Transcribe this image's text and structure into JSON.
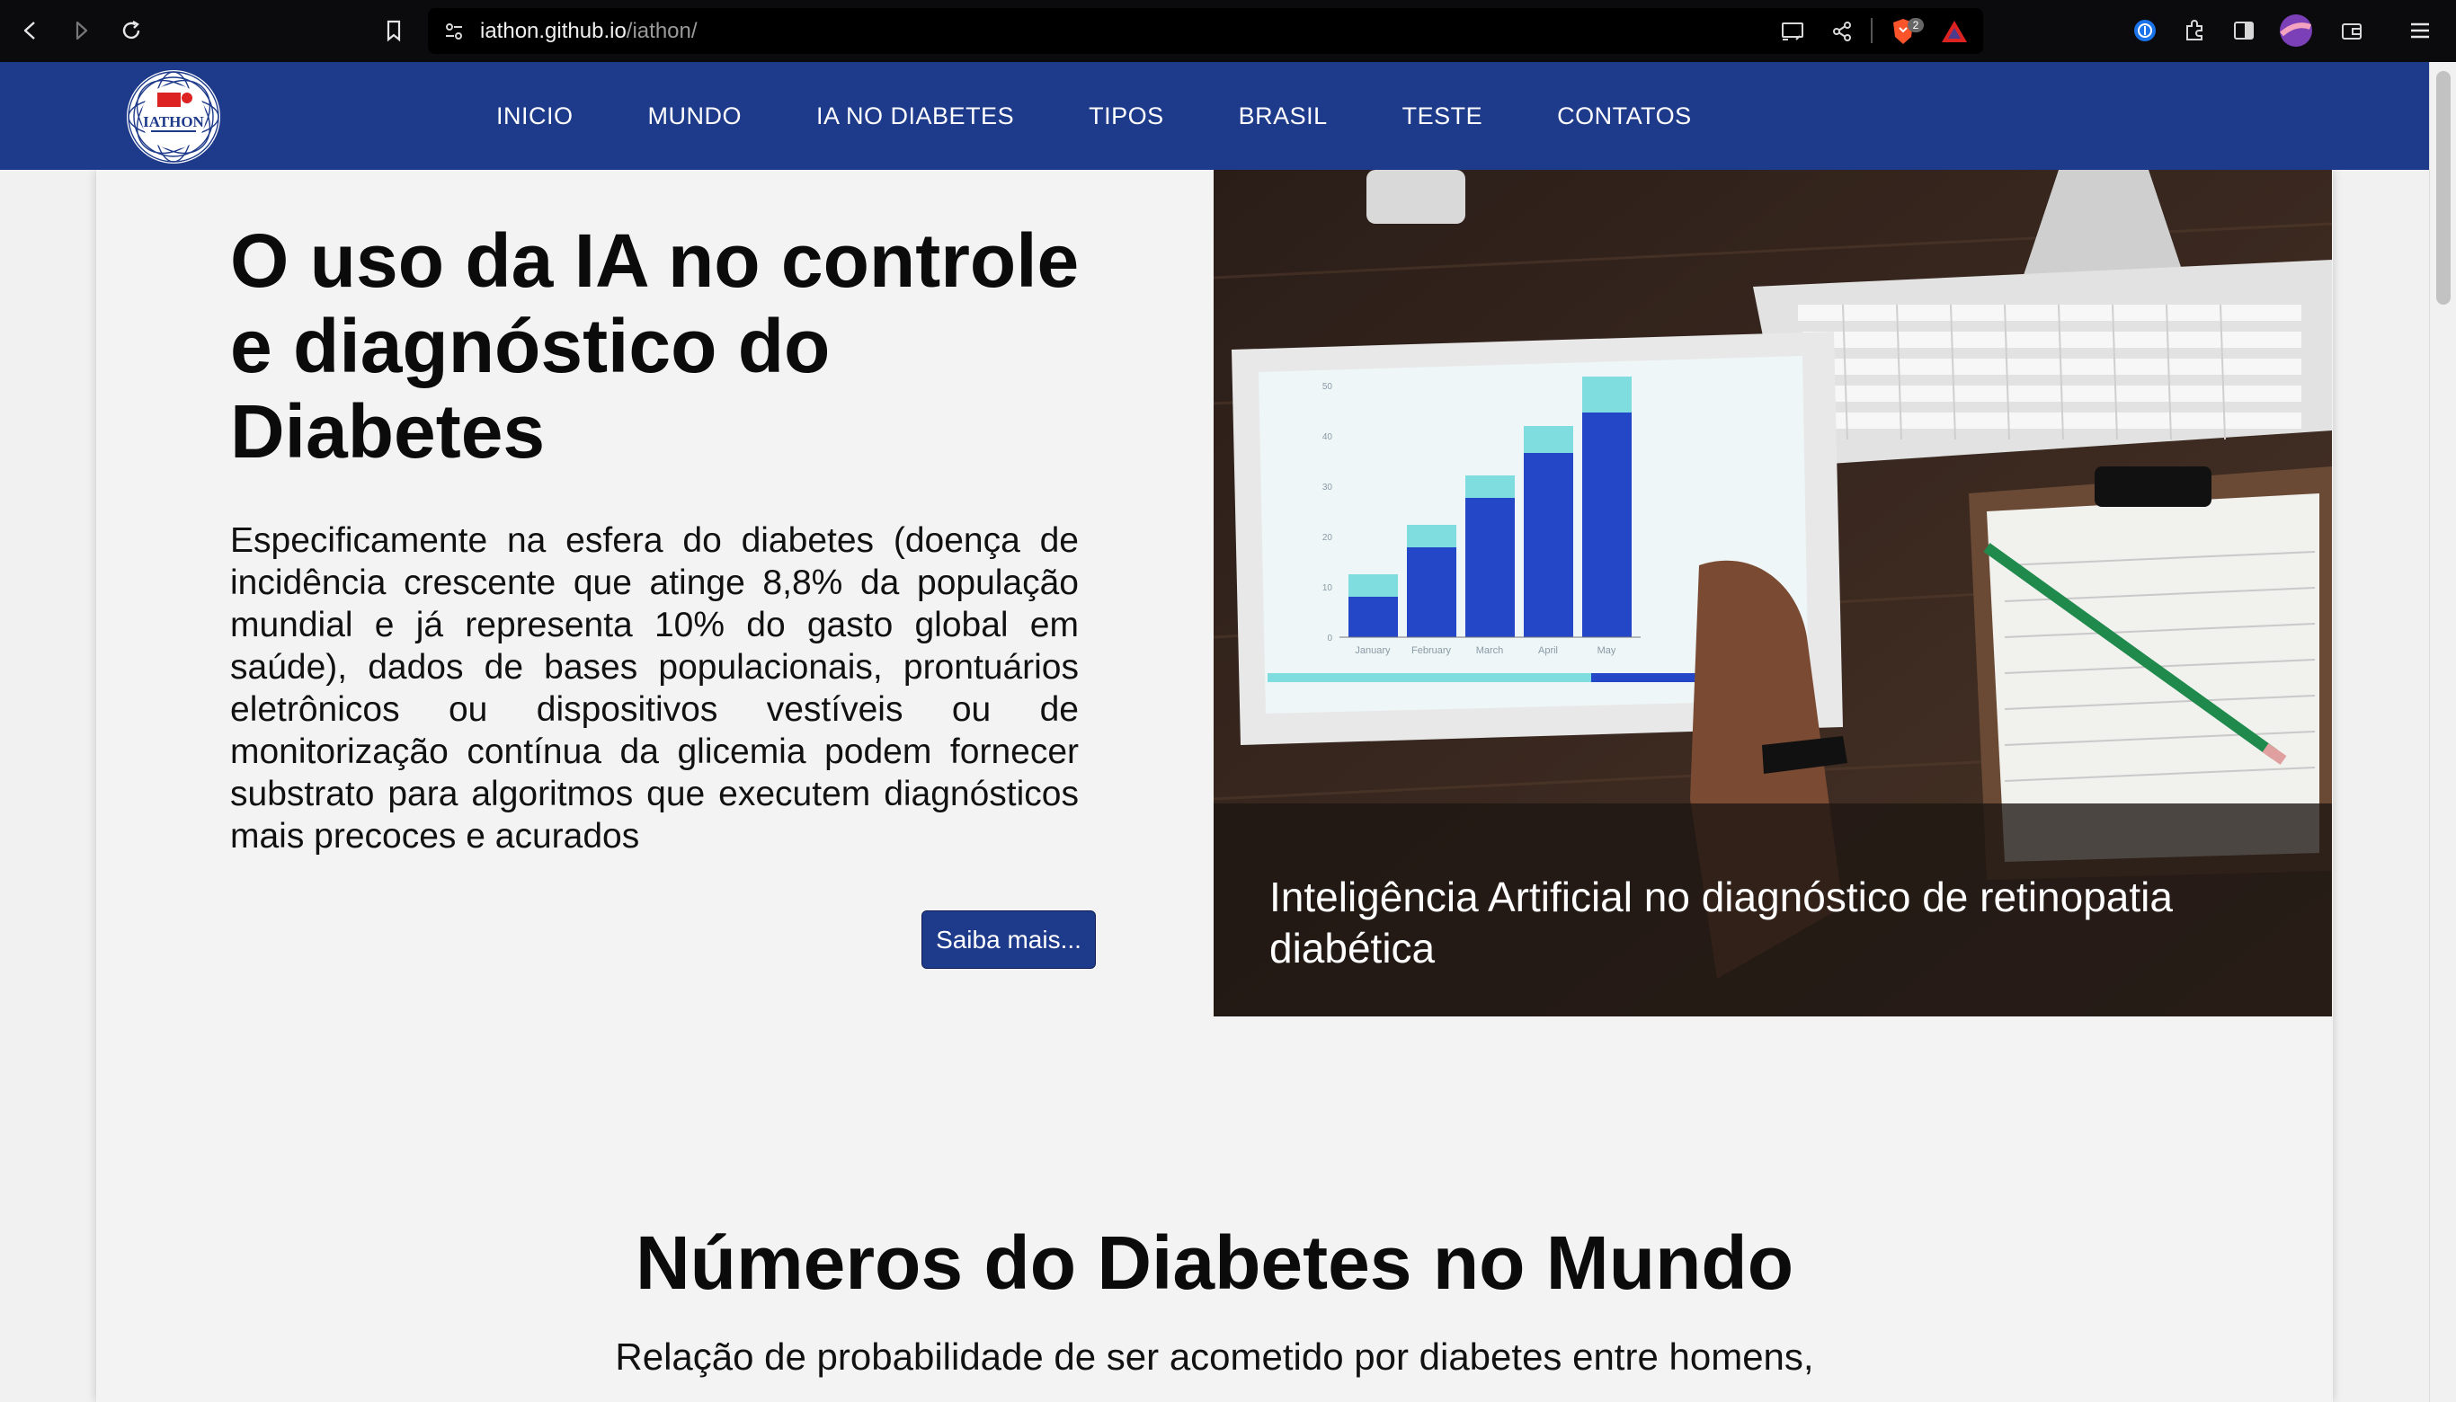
{
  "browser": {
    "url_host": "iathon.github.io",
    "url_path": "/iathon/",
    "shields_count": "2"
  },
  "site": {
    "logo_text": "IATHON",
    "nav": [
      {
        "label": "INICIO"
      },
      {
        "label": "MUNDO"
      },
      {
        "label": "IA NO DIABETES"
      },
      {
        "label": "TIPOS"
      },
      {
        "label": "BRASIL"
      },
      {
        "label": "TESTE"
      },
      {
        "label": "CONTATOS"
      }
    ]
  },
  "hero": {
    "title": "O uso da IA no controle e diagnóstico do Diabetes",
    "text": "Especificamente na esfera do diabetes (doença de incidência crescente que atinge 8,8% da população mundial e já representa 10% do gasto global em saúde), dados de bases populacionais, prontuários eletrônicos ou dispositivos vestíveis ou de monitorização contínua da glicemia podem fornecer substrato para algoritmos que executem diagnósticos mais precoces e acurados",
    "button_label": "Saiba mais...",
    "image_caption": "Inteligência Artificial no diagnóstico de retinopatia diabética",
    "tablet_chart": {
      "months": [
        "January",
        "February",
        "March",
        "April",
        "May"
      ],
      "y_ticks": [
        "0",
        "10",
        "20",
        "30",
        "40",
        "50"
      ]
    }
  },
  "section": {
    "title": "Números do Diabetes no Mundo",
    "subtitle": "Relação de probabilidade de ser acometido por diabetes entre homens,"
  },
  "colors": {
    "nav_bg": "#1e3a8a",
    "button_bg": "#1e3a8a",
    "page_bg": "#f3f3f3"
  }
}
